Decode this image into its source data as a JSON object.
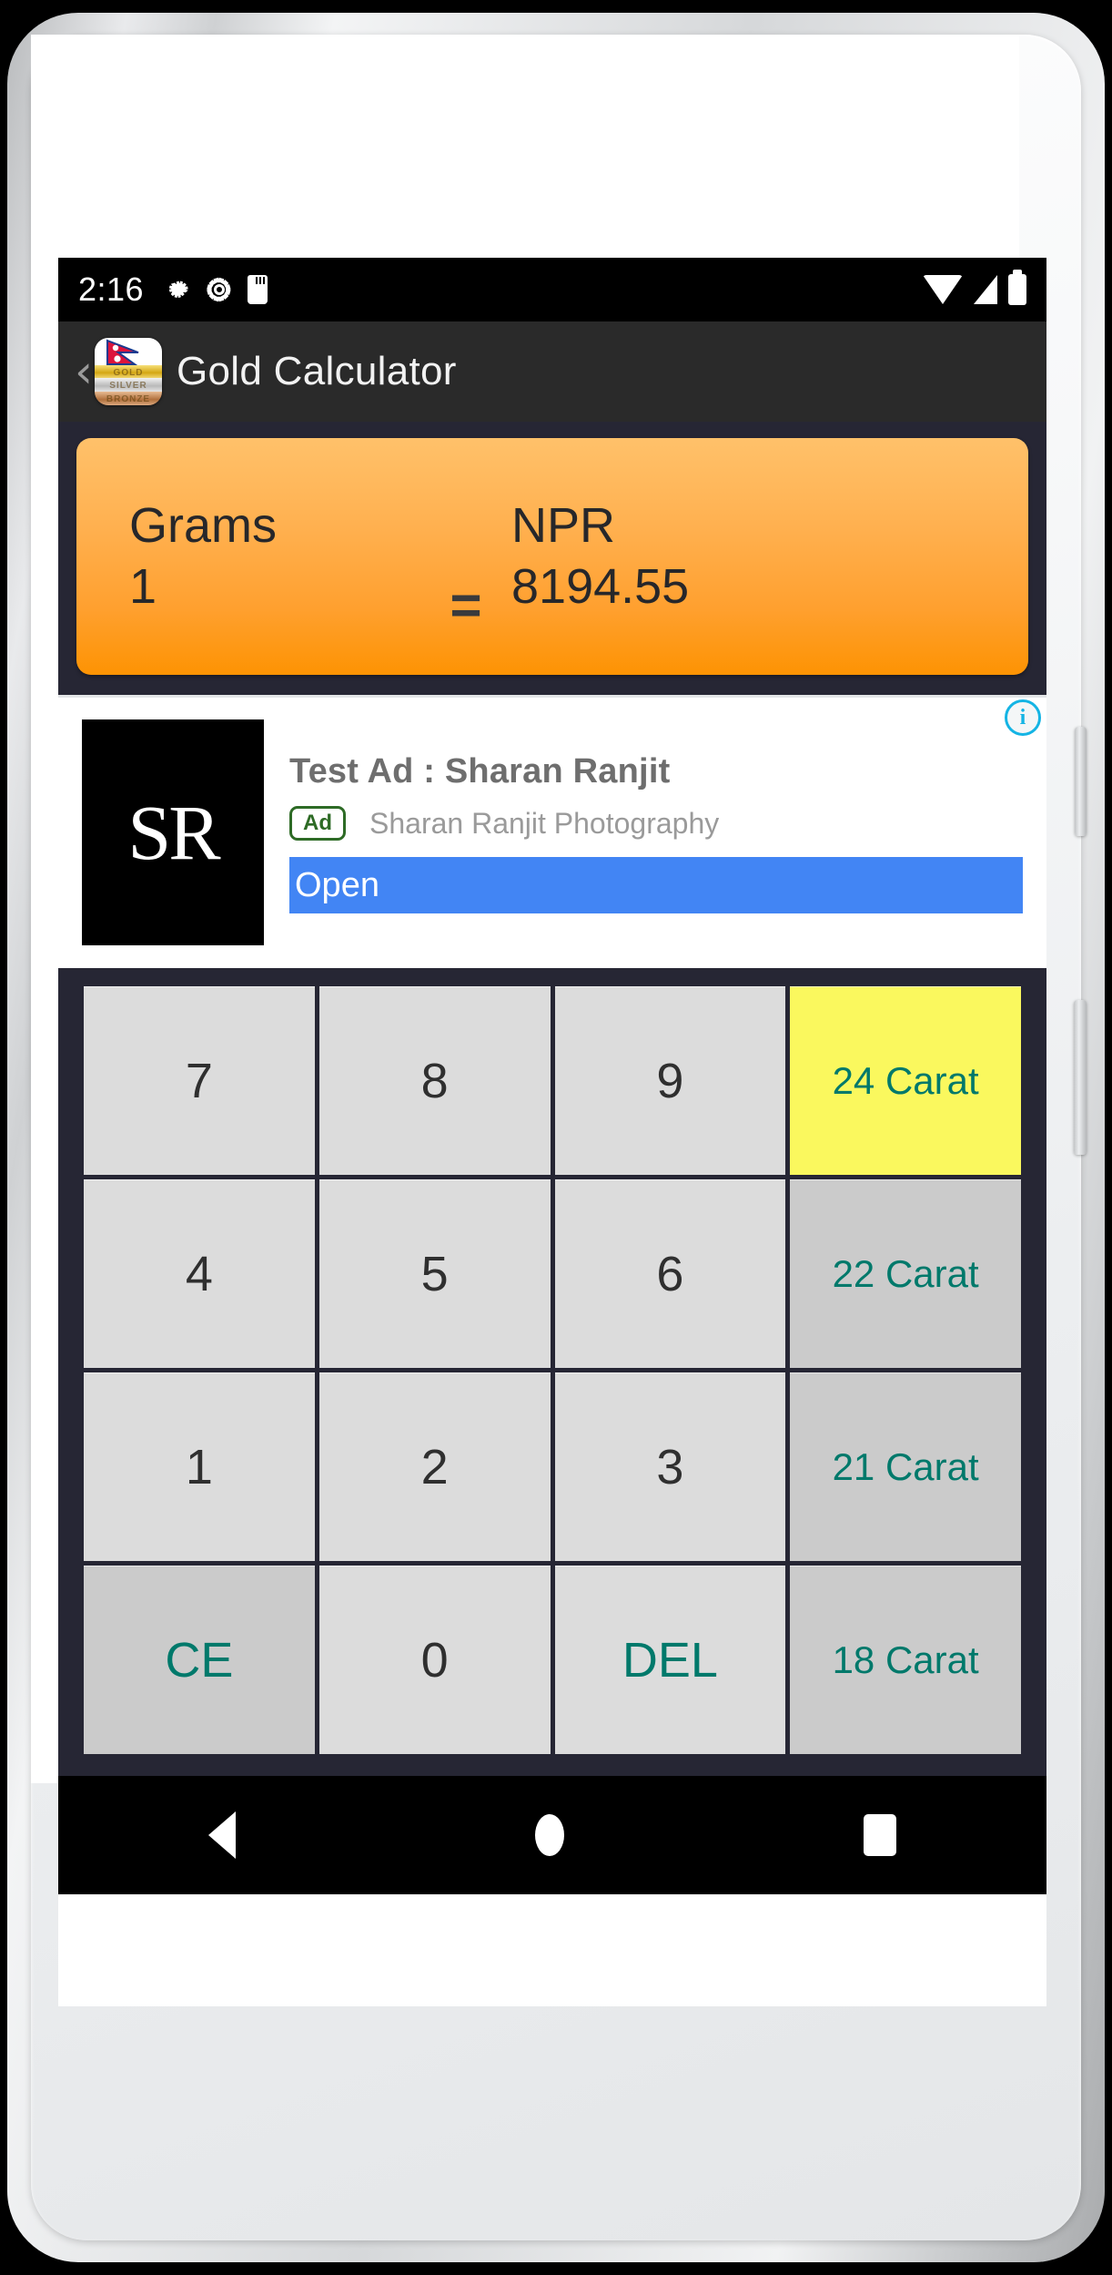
{
  "status_bar": {
    "time": "2:16",
    "left_icons": [
      "gear-icon",
      "gear-icon",
      "sd-card-icon"
    ],
    "right_icons": [
      "wifi-icon",
      "signal-icon",
      "battery-icon"
    ]
  },
  "app_bar": {
    "back_label": "‹",
    "app_icon": {
      "name": "gold-calculator-app-icon",
      "bands": [
        "GOLD",
        "SILVER",
        "BRONZE"
      ],
      "flag": "nepal-flag"
    },
    "title": "Gold Calculator"
  },
  "conversion": {
    "from_unit": "Grams",
    "from_value": "1",
    "equals": "=",
    "to_unit": "NPR",
    "to_value": "8194.55"
  },
  "ad": {
    "thumb_text": "SR",
    "headline": "Test Ad : Sharan Ranjit",
    "badge": "Ad",
    "advertiser": "Sharan Ranjit Photography",
    "cta": "Open",
    "info_glyph": "i"
  },
  "keypad": {
    "rows": [
      [
        {
          "label": "7",
          "type": "digit"
        },
        {
          "label": "8",
          "type": "digit"
        },
        {
          "label": "9",
          "type": "digit"
        },
        {
          "label": "24 Carat",
          "type": "carat",
          "selected": true
        }
      ],
      [
        {
          "label": "4",
          "type": "digit"
        },
        {
          "label": "5",
          "type": "digit"
        },
        {
          "label": "6",
          "type": "digit"
        },
        {
          "label": "22 Carat",
          "type": "carat",
          "selected": false
        }
      ],
      [
        {
          "label": "1",
          "type": "digit"
        },
        {
          "label": "2",
          "type": "digit"
        },
        {
          "label": "3",
          "type": "digit"
        },
        {
          "label": "21 Carat",
          "type": "carat",
          "selected": false
        }
      ],
      [
        {
          "label": "CE",
          "type": "action"
        },
        {
          "label": "0",
          "type": "digit"
        },
        {
          "label": "DEL",
          "type": "action-light"
        },
        {
          "label": "18 Carat",
          "type": "carat",
          "selected": false
        }
      ]
    ]
  },
  "nav_bar": {
    "back": "back-triangle-icon",
    "home": "home-circle-icon",
    "recents": "recents-square-icon"
  },
  "colors": {
    "accent_orange": "#ffa02f",
    "selected_yellow": "#faf85e",
    "teal": "#00796b",
    "ad_blue": "#4285f4",
    "keypad_bg": "#262634",
    "appbar_bg": "#2a2a2a"
  }
}
